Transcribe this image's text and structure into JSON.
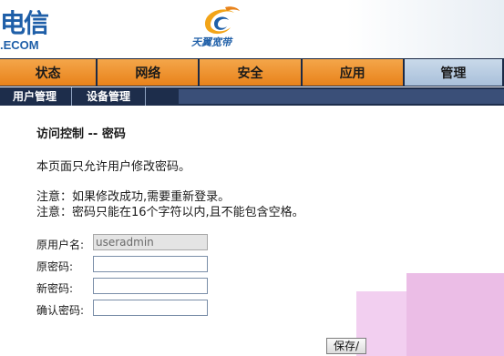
{
  "brand": {
    "name_cn": "电信",
    "name_en": ".ECOM",
    "product_name": "天翼宽带"
  },
  "colors": {
    "nav_orange": "#f08a24",
    "nav_active": "#b8cce2",
    "nav_dark": "#1b2a46",
    "brand_blue": "#1f5fa8"
  },
  "main_nav": {
    "tabs": [
      {
        "label": "状态"
      },
      {
        "label": "网络"
      },
      {
        "label": "安全"
      },
      {
        "label": "应用"
      },
      {
        "label": "管理"
      }
    ],
    "active": "管理"
  },
  "sub_nav": {
    "items": [
      {
        "label": "用户管理"
      },
      {
        "label": "设备管理"
      }
    ]
  },
  "page": {
    "title": "访问控制 -- 密码",
    "description": "本页面只允许用户修改密码。",
    "note1": "注意：如果修改成功,需要重新登录。",
    "note2": "注意：密码只能在16个字符以内,且不能包含空格。"
  },
  "form": {
    "username_label": "原用户名:",
    "username_value": "useradmin",
    "old_password_label": "原密码:",
    "new_password_label": "新密码:",
    "confirm_password_label": "确认密码:",
    "save_label": "保存/"
  },
  "icons": {
    "logo": "china-telecom-logo-icon"
  }
}
